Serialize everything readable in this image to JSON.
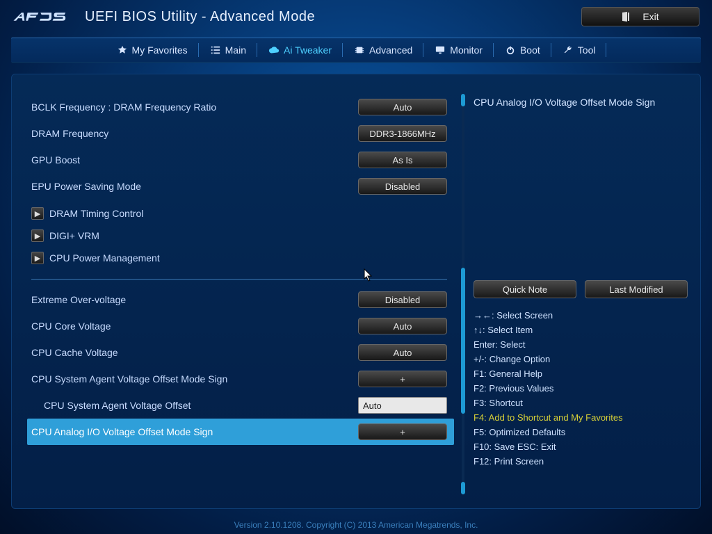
{
  "header": {
    "title": "UEFI BIOS Utility - Advanced Mode",
    "exit_label": "Exit"
  },
  "tabs": [
    {
      "icon": "star",
      "label": "My Favorites",
      "active": false
    },
    {
      "icon": "list",
      "label": "Main",
      "active": false
    },
    {
      "icon": "cloud",
      "label": "Ai Tweaker",
      "active": true
    },
    {
      "icon": "chip",
      "label": "Advanced",
      "active": false
    },
    {
      "icon": "monitor",
      "label": "Monitor",
      "active": false
    },
    {
      "icon": "power",
      "label": "Boot",
      "active": false
    },
    {
      "icon": "tool",
      "label": "Tool",
      "active": false
    }
  ],
  "settings_top": [
    {
      "label": "BCLK Frequency : DRAM Frequency Ratio",
      "value": "Auto",
      "kind": "btn"
    },
    {
      "label": "DRAM Frequency",
      "value": "DDR3-1866MHz",
      "kind": "btn"
    },
    {
      "label": "GPU Boost",
      "value": "As Is",
      "kind": "btn"
    },
    {
      "label": "EPU Power Saving Mode",
      "value": "Disabled",
      "kind": "btn"
    }
  ],
  "submenus": [
    {
      "label": "DRAM Timing Control"
    },
    {
      "label": "DIGI+ VRM"
    },
    {
      "label": "CPU Power Management"
    }
  ],
  "settings_bottom": [
    {
      "label": "Extreme Over-voltage",
      "value": "Disabled",
      "kind": "btn"
    },
    {
      "label": "CPU Core Voltage",
      "value": "Auto",
      "kind": "btn"
    },
    {
      "label": "CPU Cache Voltage",
      "value": "Auto",
      "kind": "btn"
    },
    {
      "label": "CPU System Agent Voltage Offset Mode Sign",
      "value": "+",
      "kind": "btn"
    },
    {
      "label": "CPU System Agent Voltage Offset",
      "value": "Auto",
      "kind": "input",
      "indent": true
    },
    {
      "label": "CPU Analog I/O Voltage Offset Mode Sign",
      "value": "+",
      "kind": "btn",
      "selected": true
    }
  ],
  "help_text": "CPU Analog I/O Voltage Offset Mode Sign",
  "right_buttons": {
    "quick_note": "Quick Note",
    "last_modified": "Last Modified"
  },
  "keyhelp": [
    {
      "k": "→←",
      "t": ": Select Screen"
    },
    {
      "k": "↑↓",
      "t": ": Select Item"
    },
    {
      "k": "Enter",
      "t": ": Select"
    },
    {
      "k": "+/-",
      "t": ": Change Option"
    },
    {
      "k": "F1",
      "t": ": General Help"
    },
    {
      "k": "F2",
      "t": ": Previous Values"
    },
    {
      "k": "F3",
      "t": ": Shortcut"
    },
    {
      "k": "F4",
      "t": ": Add to Shortcut and My Favorites",
      "hl": true
    },
    {
      "k": "F5",
      "t": ": Optimized Defaults"
    },
    {
      "k": "F10",
      "t": ": Save  ESC: Exit"
    },
    {
      "k": "F12",
      "t": ": Print Screen"
    }
  ],
  "footer": "Version 2.10.1208. Copyright (C) 2013 American Megatrends, Inc."
}
